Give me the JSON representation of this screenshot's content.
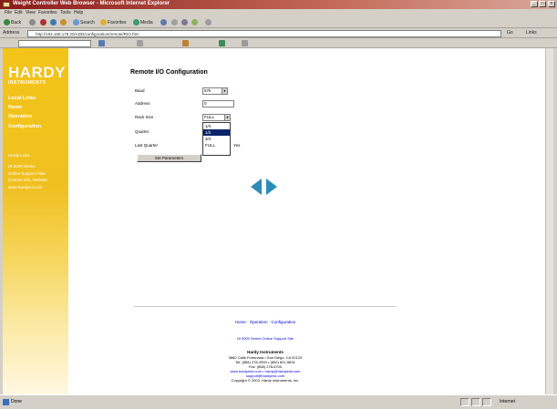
{
  "window": {
    "title": "Weight Controller Web Browser - Microsoft Internet Explorer",
    "controls": [
      "_",
      "□",
      "×"
    ]
  },
  "menu": [
    "File",
    "Edit",
    "View",
    "Favorites",
    "Tools",
    "Help"
  ],
  "toolbar": {
    "back": "Back",
    "search": "Search",
    "favorites": "Favorites",
    "media": "Media"
  },
  "address": {
    "label": "Address",
    "url": "http://192.168.178.20/ADD/configuration/remote/RIO.htm",
    "go": "Go",
    "links": "Links"
  },
  "sidebar": {
    "logo": "HARDY",
    "logo_sub": "INSTRUMENTS",
    "nav": [
      "Local Links",
      "Home",
      "Operation",
      "Configuration"
    ],
    "sub": [
      "Hardy Links",
      "HI 3000 Series",
      "Online Support Files",
      "Contact Info, Website",
      "www.hardysol.com"
    ]
  },
  "page": {
    "title": "Remote I/O Configuration",
    "fields": [
      {
        "label": "Baud",
        "value": "57k"
      },
      {
        "label": "Address",
        "value": "0"
      },
      {
        "label": "Rack Size",
        "value": "FULL"
      },
      {
        "label": "Quarter",
        "value": ""
      },
      {
        "label": "Last Quarter",
        "value": "",
        "suffix": "Yes"
      }
    ],
    "listbox_options": [
      "1/4",
      "1/2",
      "3/4",
      "FULL"
    ],
    "listbox_selected_index": 1,
    "button": "Set Parameters"
  },
  "footer": {
    "links": [
      "Home",
      "Operation",
      "Configuration"
    ],
    "series_link": "HI 3000 Series Online Support Site",
    "company": "Hardy Instruments",
    "address": "3860 Calle Fortunada • San Diego, CA 92123",
    "phone": "Tel: (858) 278-2900 • (800) 821-5831",
    "fax": "Fax: (858) 278-6700",
    "web": "www.hardyinst.com • hardy@hardyinst.com",
    "support": "support@hardyinst.com",
    "copyright": "Copyright © 2003, Hardy Instruments, Inc."
  },
  "status": {
    "text": "Done",
    "zone": "Internet"
  }
}
